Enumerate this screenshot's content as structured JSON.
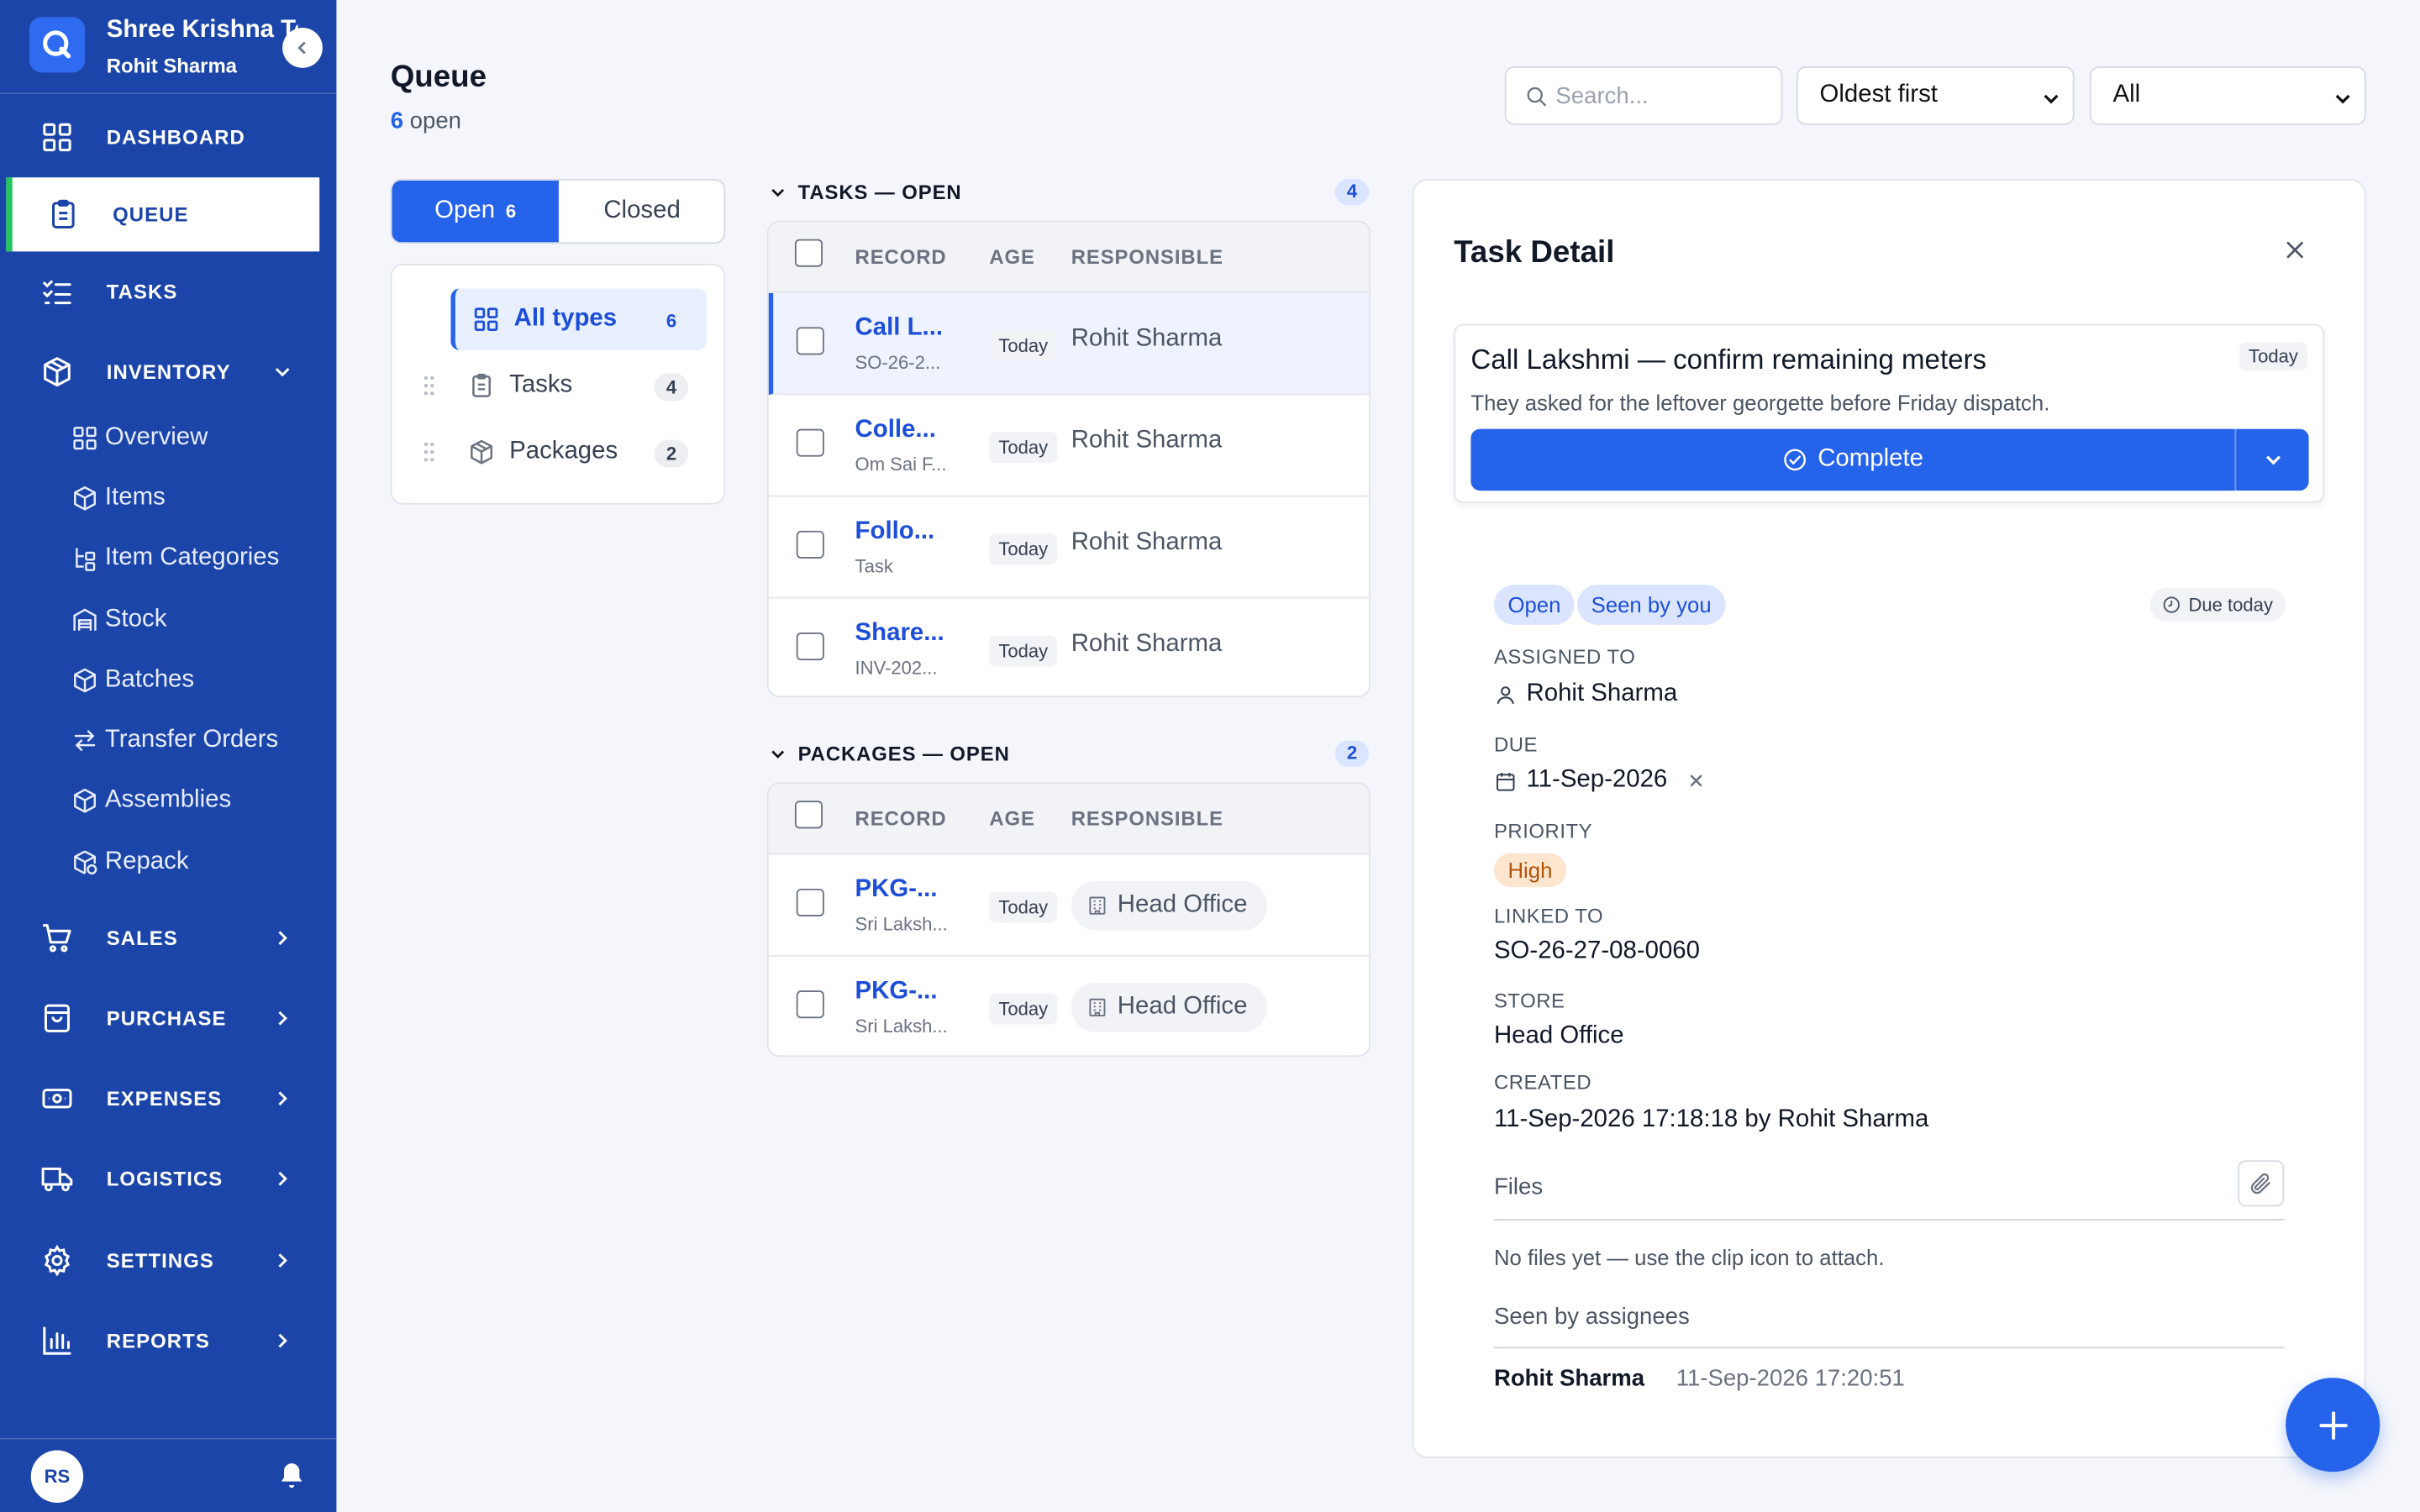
{
  "sidebar": {
    "org_name": "Shree Krishna Textiles",
    "user_name": "Rohit Sharma",
    "nav": {
      "dashboard": "DASHBOARD",
      "queue": "QUEUE",
      "tasks": "TASKS",
      "inventory": "INVENTORY",
      "sales": "SALES",
      "purchase": "PURCHASE",
      "expenses": "EXPENSES",
      "logistics": "LOGISTICS",
      "settings": "SETTINGS",
      "reports": "REPORTS"
    },
    "inventory_items": [
      "Overview",
      "Items",
      "Item Categories",
      "Stock",
      "Batches",
      "Transfer Orders",
      "Assemblies",
      "Repack"
    ],
    "avatar_initials": "RS"
  },
  "header": {
    "title": "Queue",
    "open_count": "6",
    "open_label": "open",
    "search_placeholder": "Search...",
    "sort_value": "Oldest first",
    "filter_value": "All"
  },
  "status_tabs": {
    "open_label": "Open",
    "open_count": "6",
    "closed_label": "Closed"
  },
  "type_filters": [
    {
      "label": "All types",
      "count": "6"
    },
    {
      "label": "Tasks",
      "count": "4"
    },
    {
      "label": "Packages",
      "count": "2"
    }
  ],
  "columns": {
    "record": "RECORD",
    "age": "AGE",
    "responsible": "RESPONSIBLE"
  },
  "tasks_section": {
    "title": "TASKS — OPEN",
    "count": "4",
    "rows": [
      {
        "title": "Call L...",
        "sub": "SO-26-2...",
        "age": "Today",
        "responsible": "Rohit Sharma"
      },
      {
        "title": "Colle...",
        "sub": "Om Sai F...",
        "age": "Today",
        "responsible": "Rohit Sharma"
      },
      {
        "title": "Follo...",
        "sub": "Task",
        "age": "Today",
        "responsible": "Rohit Sharma"
      },
      {
        "title": "Share...",
        "sub": "INV-202...",
        "age": "Today",
        "responsible": "Rohit Sharma"
      }
    ]
  },
  "packages_section": {
    "title": "PACKAGES — OPEN",
    "count": "2",
    "rows": [
      {
        "title": "PKG-...",
        "sub": "Sri Laksh...",
        "age": "Today",
        "responsible": "Head Office"
      },
      {
        "title": "PKG-...",
        "sub": "Sri Laksh...",
        "age": "Today",
        "responsible": "Head Office"
      }
    ]
  },
  "detail": {
    "title": "Task Detail",
    "task_title": "Call Lakshmi — confirm remaining meters",
    "task_age": "Today",
    "task_desc": "They asked for the leftover georgette before Friday dispatch.",
    "complete_label": "Complete",
    "status_open": "Open",
    "status_seen": "Seen by you",
    "due_label": "Due today",
    "assigned_label": "ASSIGNED TO",
    "assigned_value": "Rohit Sharma",
    "due_field_label": "DUE",
    "due_value": "11-Sep-2026",
    "priority_label": "PRIORITY",
    "priority_value": "High",
    "linked_label": "LINKED TO",
    "linked_value": "SO-26-27-08-0060",
    "store_label": "STORE",
    "store_value": "Head Office",
    "created_label": "CREATED",
    "created_value": "11-Sep-2026 17:18:18 by Rohit Sharma",
    "files_label": "Files",
    "files_empty": "No files yet — use the clip icon to attach.",
    "seen_label": "Seen by assignees",
    "seen_name": "Rohit Sharma",
    "seen_time": "11-Sep-2026 17:20:51"
  },
  "colors": {
    "sidebar": "#1b45a8",
    "accent": "#2563eb",
    "active_marker": "#22c55e",
    "priority_high_bg": "#fde6cf"
  }
}
